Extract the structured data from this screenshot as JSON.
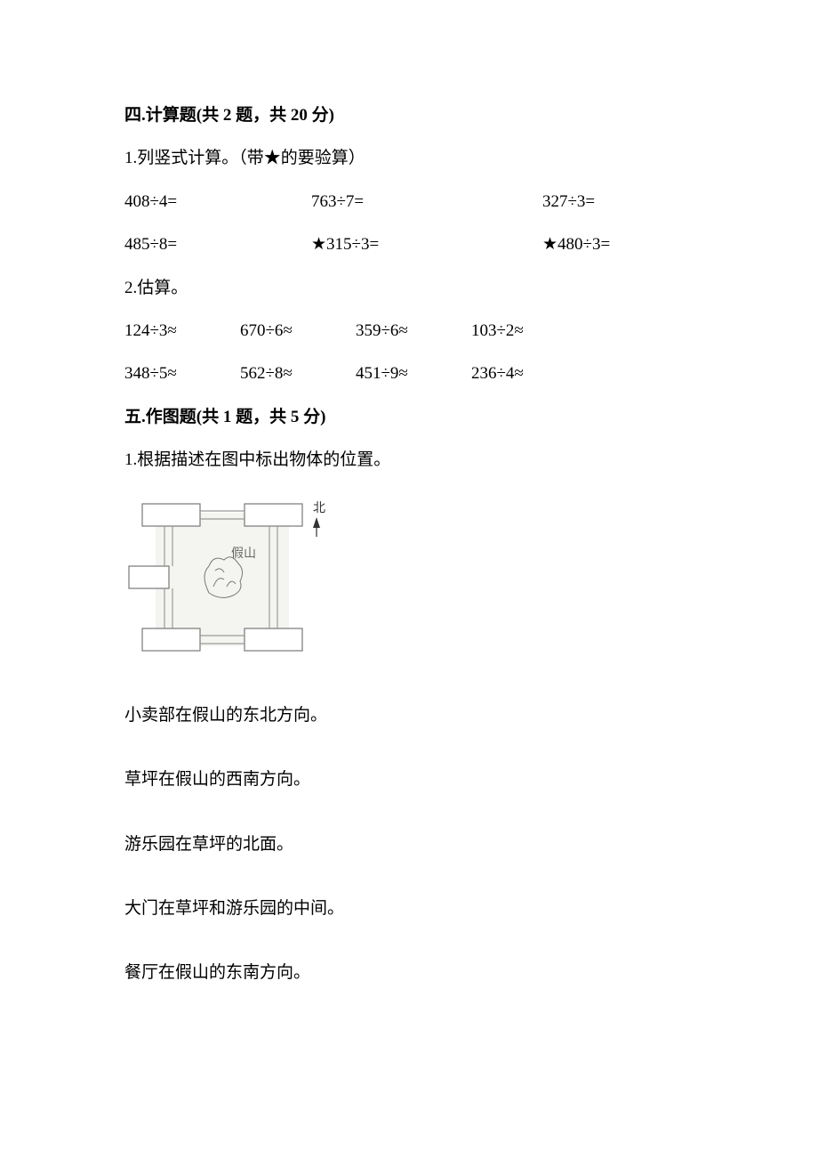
{
  "section4": {
    "heading": "四.计算题(共 2 题，共 20 分)",
    "q1": {
      "prompt": "1.列竖式计算。（带★的要验算）",
      "rows": [
        {
          "a": "408÷4=",
          "b": "763÷7=",
          "c": "327÷3="
        },
        {
          "a": "485÷8=",
          "b": "★315÷3=",
          "c": "★480÷3="
        }
      ]
    },
    "q2": {
      "prompt": "2.估算。",
      "rows": [
        {
          "a": "124÷3≈",
          "b": "670÷6≈",
          "c": "359÷6≈",
          "d": "103÷2≈"
        },
        {
          "a": "348÷5≈",
          "b": "562÷8≈",
          "c": "451÷9≈",
          "d": "236÷4≈"
        }
      ]
    }
  },
  "section5": {
    "heading": "五.作图题(共 1 题，共 5 分)",
    "q1": {
      "prompt": "1.根据描述在图中标出物体的位置。",
      "compass": "北",
      "center_label": "假山",
      "descriptions": [
        "小卖部在假山的东北方向。",
        "草坪在假山的西南方向。",
        "游乐园在草坪的北面。",
        "大门在草坪和游乐园的中间。",
        "餐厅在假山的东南方向。"
      ]
    }
  }
}
